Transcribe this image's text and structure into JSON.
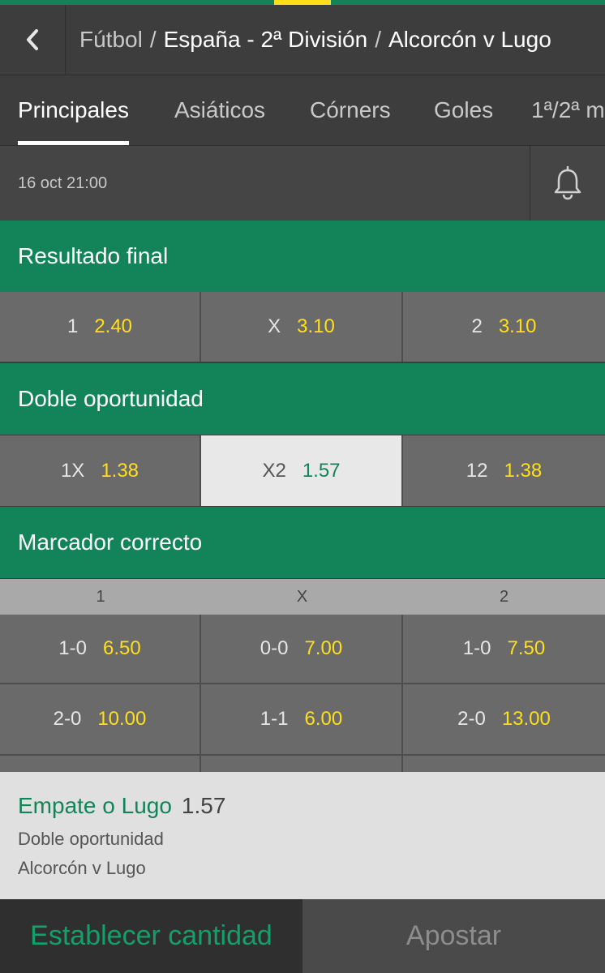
{
  "header": {
    "back_icon": "chevron-left-icon",
    "breadcrumb": {
      "sport": "Fútbol",
      "separator": "/",
      "league": "España - 2ª División",
      "event": "Alcorcón v Lugo"
    }
  },
  "tabs": [
    {
      "label": "Principales",
      "active": true
    },
    {
      "label": "Asiáticos",
      "active": false
    },
    {
      "label": "Córners",
      "active": false
    },
    {
      "label": "Goles",
      "active": false
    },
    {
      "label": "1ª/2ª m",
      "active": false
    }
  ],
  "event_info": {
    "date": "16 oct 21:00",
    "bell_icon": "bell-icon"
  },
  "markets": {
    "resultado_final": {
      "title": "Resultado final",
      "outcomes": [
        {
          "label": "1",
          "odd": "2.40"
        },
        {
          "label": "X",
          "odd": "3.10"
        },
        {
          "label": "2",
          "odd": "3.10"
        }
      ]
    },
    "doble_oportunidad": {
      "title": "Doble oportunidad",
      "outcomes": [
        {
          "label": "1X",
          "odd": "1.38",
          "selected": false
        },
        {
          "label": "X2",
          "odd": "1.57",
          "selected": true
        },
        {
          "label": "12",
          "odd": "1.38",
          "selected": false
        }
      ]
    },
    "marcador_correcto": {
      "title": "Marcador correcto",
      "columns": [
        "1",
        "X",
        "2"
      ],
      "rows": [
        [
          {
            "label": "1-0",
            "odd": "6.50"
          },
          {
            "label": "0-0",
            "odd": "7.00"
          },
          {
            "label": "1-0",
            "odd": "7.50"
          }
        ],
        [
          {
            "label": "2-0",
            "odd": "10.00"
          },
          {
            "label": "1-1",
            "odd": "6.00"
          },
          {
            "label": "2-0",
            "odd": "13.00"
          }
        ]
      ]
    }
  },
  "betslip": {
    "selection": "Empate o Lugo",
    "odd": "1.57",
    "market": "Doble oportunidad",
    "event": "Alcorcón v Lugo"
  },
  "footer": {
    "amount_label": "Establecer cantidad",
    "bet_label": "Apostar"
  },
  "colors": {
    "brand_green": "#13845a",
    "accent_yellow": "#ffdf1b",
    "cell_gray": "#6a6a6a",
    "background": "#3d3d3d"
  }
}
